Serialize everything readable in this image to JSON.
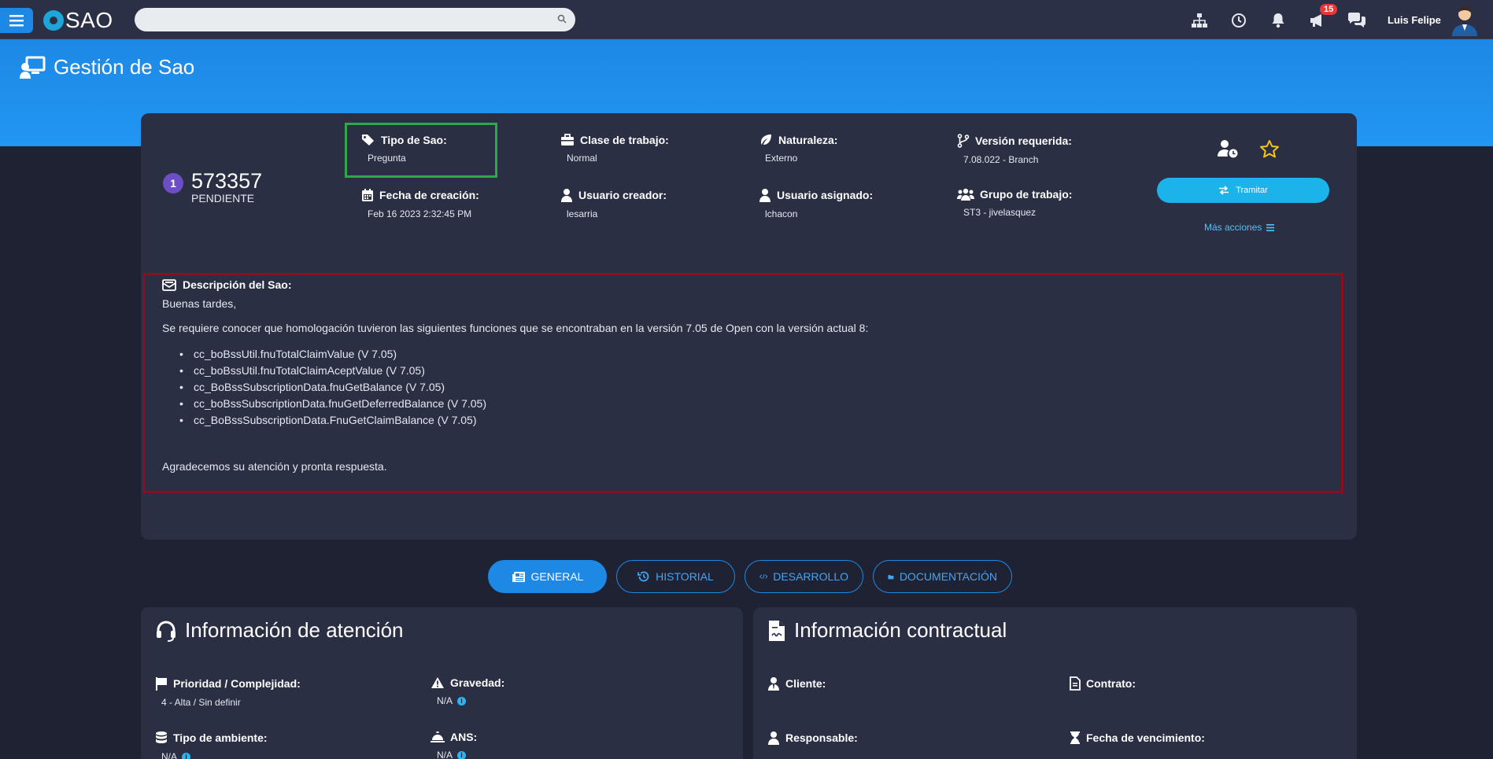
{
  "topbar": {
    "logo_text": "SAO",
    "search": {
      "value": "",
      "placeholder": ""
    },
    "notifications_badge": "15",
    "user_name": "Luis Felipe",
    "icons": [
      "menu-icon",
      "sitemap-icon",
      "clock-icon",
      "bell-icon",
      "megaphone-icon",
      "chat-icon"
    ]
  },
  "page": {
    "title": "Gestión de Sao"
  },
  "sao": {
    "step": "1",
    "number": "573357",
    "status": "PENDIENTE",
    "fields": {
      "tipo": {
        "label": "Tipo de Sao:",
        "value": "Pregunta"
      },
      "clase": {
        "label": "Clase de trabajo:",
        "value": "Normal"
      },
      "naturaleza": {
        "label": "Naturaleza:",
        "value": "Externo"
      },
      "version": {
        "label": "Versión requerida:",
        "value": "7.08.022 - Branch"
      },
      "fecha": {
        "label": "Fecha de creación:",
        "value": "Feb 16 2023 2:32:45 PM"
      },
      "creador": {
        "label": "Usuario creador:",
        "value": "lesarria"
      },
      "asignado": {
        "label": "Usuario asignado:",
        "value": "lchacon"
      },
      "grupo": {
        "label": "Grupo de trabajo:",
        "value": "ST3 - jivelasquez"
      }
    },
    "actions": {
      "tramitar": "Tramitar",
      "mas_acciones": "Más acciones"
    },
    "description": {
      "title": "Descripción del Sao:",
      "greeting": "Buenas tardes,",
      "intro": "Se requiere conocer que homologación tuvieron las siguientes funciones que se encontraban en la versión 7.05 de Open con la versión actual 8:",
      "items": [
        "cc_boBssUtil.fnuTotalClaimValue (V 7.05)",
        "cc_boBssUtil.fnuTotalClaimAceptValue (V 7.05)",
        "cc_BoBssSubscriptionData.fnuGetBalance (V 7.05)",
        "cc_boBssSubscriptionData.fnuGetDeferredBalance (V 7.05)",
        "cc_BoBssSubscriptionData.FnuGetClaimBalance (V 7.05)"
      ],
      "closing": "Agradecemos su atención y pronta respuesta."
    }
  },
  "tabs": {
    "general": "GENERAL",
    "historial": "HISTORIAL",
    "desarrollo": "DESARROLLO",
    "documentacion": "DOCUMENTACIÓN"
  },
  "atencion": {
    "title": "Información de atención",
    "prioridad": {
      "label": "Prioridad / Complejidad:",
      "value": "4 - Alta / Sin definir"
    },
    "gravedad": {
      "label": "Gravedad:",
      "value": "N/A"
    },
    "ambiente": {
      "label": "Tipo de ambiente:",
      "value": "N/A"
    },
    "ans": {
      "label": "ANS:",
      "value": "N/A"
    }
  },
  "contractual": {
    "title": "Información contractual",
    "cliente": {
      "label": "Cliente:"
    },
    "contrato": {
      "label": "Contrato:"
    },
    "responsable": {
      "label": "Responsable:"
    },
    "vencimiento": {
      "label": "Fecha de vencimiento:"
    }
  },
  "colors": {
    "navbar": "#2c3046",
    "header": "#1e88e5",
    "card": "#2b2f44",
    "accent": "#1bb3ea",
    "highlight_green": "#2ea84a",
    "highlight_red": "#8b0f1f"
  }
}
